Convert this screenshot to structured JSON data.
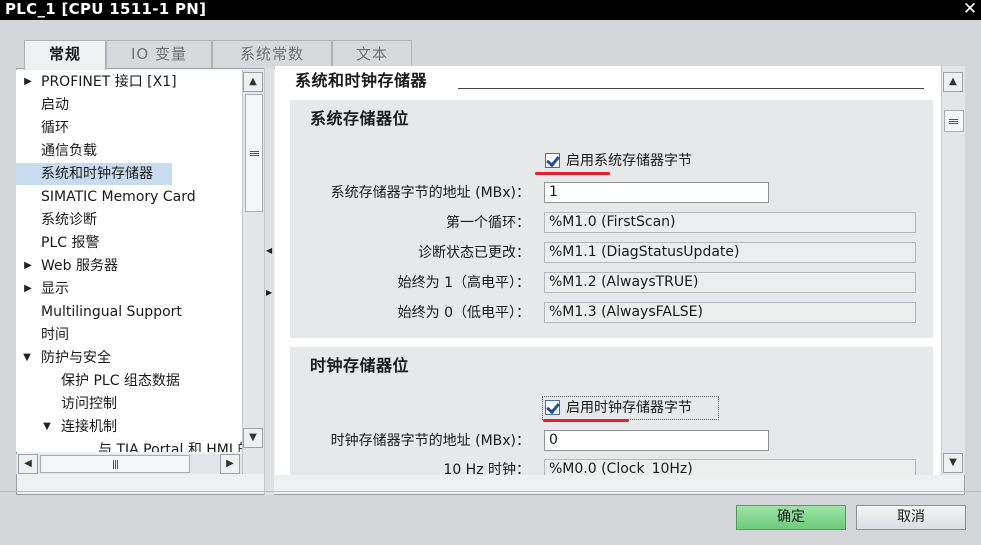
{
  "window": {
    "title": "PLC_1 [CPU 1511-1 PN]",
    "close_glyph": "✕"
  },
  "tabs": [
    {
      "label": "常规",
      "active": true
    },
    {
      "label": "IO 变量",
      "active": false
    },
    {
      "label": "系统常数",
      "active": false
    },
    {
      "label": "文本",
      "active": false
    }
  ],
  "nav": {
    "items": [
      {
        "label": "PROFINET 接口 [X1]",
        "expander": "right"
      },
      {
        "label": "启动"
      },
      {
        "label": "循环"
      },
      {
        "label": "通信负载"
      },
      {
        "label": "系统和时钟存储器",
        "selected": true
      },
      {
        "label": "SIMATIC Memory Card"
      },
      {
        "label": "系统诊断"
      },
      {
        "label": "PLC 报警"
      },
      {
        "label": "Web 服务器",
        "expander": "right"
      },
      {
        "label": "显示",
        "expander": "right"
      },
      {
        "label": "Multilingual Support"
      },
      {
        "label": "时间"
      },
      {
        "label": "防护与安全",
        "expander": "down"
      },
      {
        "label": "保护 PLC 组态数据",
        "indent": 1
      },
      {
        "label": "访问控制",
        "indent": 1
      },
      {
        "label": "连接机制",
        "indent": 1,
        "expander": "down"
      },
      {
        "label": "与 TIA Portal 和 HMI 的",
        "indent": 2
      }
    ]
  },
  "main": {
    "section_title": "系统和时钟存储器",
    "system_memory": {
      "title": "系统存储器位",
      "enable_label": "启用系统存储器字节",
      "enabled": true,
      "address_label": "系统存储器字节的地址 (MBx)：",
      "address_value": "1",
      "bits": [
        {
          "label": "第一个循环：",
          "value": "%M1.0 (FirstScan)"
        },
        {
          "label": "诊断状态已更改：",
          "value": "%M1.1 (DiagStatusUpdate)"
        },
        {
          "label": "始终为 1（高电平）：",
          "value": "%M1.2 (AlwaysTRUE)"
        },
        {
          "label": "始终为 0（低电平）：",
          "value": "%M1.3 (AlwaysFALSE)"
        }
      ]
    },
    "clock_memory": {
      "title": "时钟存储器位",
      "enable_label": "启用时钟存储器字节",
      "enabled": true,
      "address_label": "时钟存储器字节的地址 (MBx)：",
      "address_value": "0",
      "bits": [
        {
          "label": "10 Hz 时钟：",
          "value": "%M0.0 (Clock_10Hz)"
        }
      ]
    }
  },
  "annotation_color": "#e3202e",
  "footer": {
    "ok_label": "确定",
    "cancel_label": "取消",
    "ok_color": "#7fd68c"
  }
}
